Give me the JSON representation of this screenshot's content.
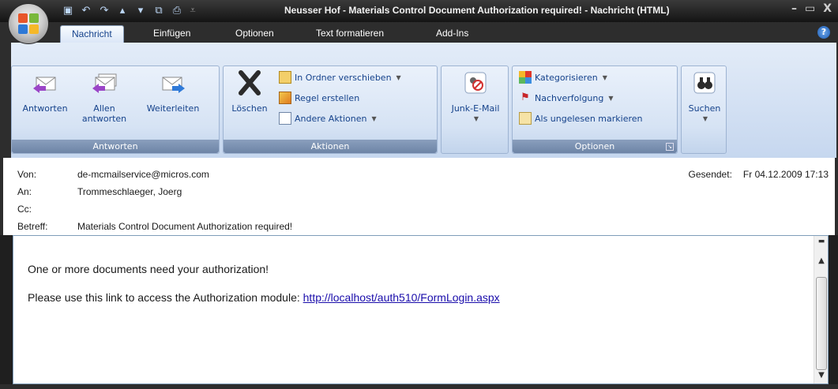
{
  "window": {
    "title": "Neusser Hof - Materials Control Document Authorization required! - Nachricht (HTML)",
    "controls": [
      "–",
      "▭",
      "X"
    ]
  },
  "qat": {
    "icons": [
      "save-icon",
      "undo-icon",
      "redo-icon",
      "previous-icon",
      "next-icon",
      "copy-icon",
      "print-icon",
      "customize-icon"
    ]
  },
  "tabs": [
    {
      "label": "Nachricht",
      "active": true
    },
    {
      "label": "Einfügen"
    },
    {
      "label": "Optionen"
    },
    {
      "label": "Text formatieren"
    },
    {
      "label": "Add-Ins"
    }
  ],
  "ribbon": {
    "antworten": {
      "label": "Antworten",
      "reply": "Antworten",
      "reply_all_1": "Allen",
      "reply_all_2": "antworten",
      "forward": "Weiterleiten"
    },
    "aktionen": {
      "label": "Aktionen",
      "delete": "Löschen",
      "move": "In Ordner verschieben",
      "rule": "Regel erstellen",
      "other": "Andere Aktionen"
    },
    "junk": {
      "label": "Junk-E-Mail"
    },
    "optionen": {
      "label": "Optionen",
      "categorize": "Kategorisieren",
      "followup": "Nachverfolgung",
      "unread": "Als ungelesen markieren"
    },
    "suchen": {
      "label": "Suchen"
    }
  },
  "header": {
    "from_label": "Von:",
    "from_value": "de-mcmailservice@micros.com",
    "to_label": "An:",
    "to_value": "Trommeschlaeger, Joerg",
    "cc_label": "Cc:",
    "cc_value": "",
    "subject_label": "Betreff:",
    "subject_value": "Materials Control Document Authorization required!",
    "sent_label": "Gesendet:",
    "sent_value": "Fr 04.12.2009 17:13"
  },
  "body": {
    "line1": "One or more documents need your authorization!",
    "line2_text": "Please use this link to access the Authorization module: ",
    "link": "http://localhost/auth510/FormLogin.aspx"
  }
}
